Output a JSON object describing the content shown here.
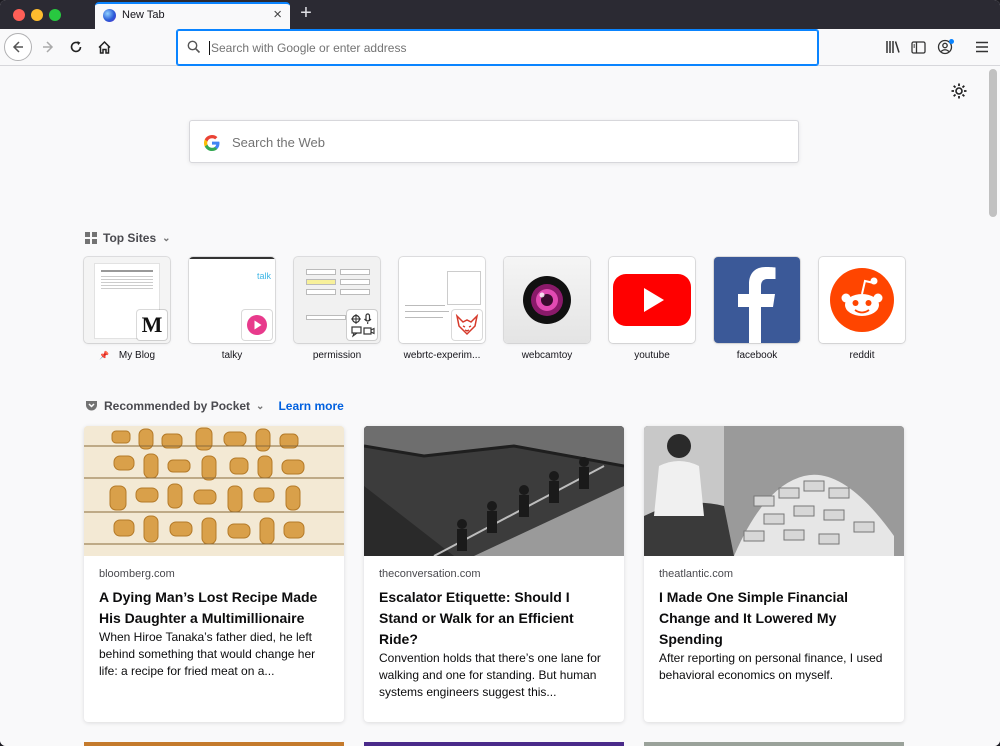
{
  "tab": {
    "title": "New Tab"
  },
  "urlbar": {
    "placeholder": "Search with Google or enter address"
  },
  "search": {
    "placeholder": "Search the Web"
  },
  "top_sites": {
    "title": "Top Sites",
    "sites": [
      {
        "label": "My Blog"
      },
      {
        "label": "talky"
      },
      {
        "label": "permission"
      },
      {
        "label": "webrtc-experim..."
      },
      {
        "label": "webcamtoy"
      },
      {
        "label": "youtube"
      },
      {
        "label": "facebook"
      },
      {
        "label": "reddit"
      }
    ]
  },
  "pocket": {
    "title": "Recommended by Pocket",
    "learn_more": "Learn more",
    "cards": [
      {
        "domain": "bloomberg.com",
        "title": "A Dying Man’s Lost Recipe Made His Daughter a Multimillionaire",
        "excerpt": "When Hiroe Tanaka’s father died, he left behind something that would change her life: a recipe for fried meat on a..."
      },
      {
        "domain": "theconversation.com",
        "title": "Escalator Etiquette: Should I Stand or Walk for an Efficient Ride?",
        "excerpt": "Convention holds that there’s one lane for walking and one for standing. But human systems engineers suggest this..."
      },
      {
        "domain": "theatlantic.com",
        "title": "I Made One Simple Financial Change and It Lowered My Spending",
        "excerpt": "After reporting on personal finance, I used behavioral economics on myself."
      }
    ]
  },
  "colors": {
    "accent": "#0a84ff",
    "link": "#0060df",
    "youtube": "#ff0000",
    "facebook": "#3b5998",
    "reddit": "#ff4500"
  }
}
